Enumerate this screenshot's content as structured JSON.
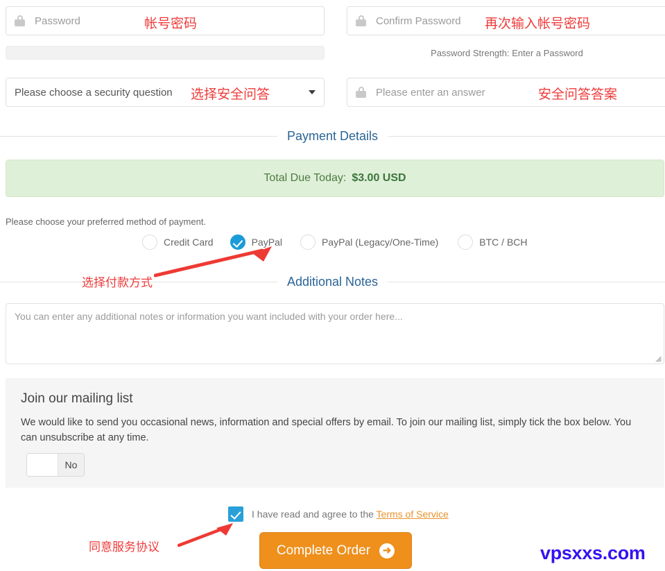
{
  "form": {
    "password_field": {
      "placeholder": "Password",
      "icon": "lock-icon"
    },
    "confirm_password_field": {
      "placeholder": "Confirm Password",
      "icon": "lock-icon"
    },
    "password_strength": "Password Strength: Enter a Password",
    "security_question_select": {
      "value": "Please choose a security question"
    },
    "security_answer_field": {
      "placeholder": "Please enter an answer",
      "icon": "lock-icon"
    }
  },
  "payment": {
    "section_title": "Payment Details",
    "total_label": "Total Due Today:",
    "total_amount": "$3.00 USD",
    "method_prompt": "Please choose your preferred method of payment.",
    "methods": [
      {
        "label": "Credit Card",
        "selected": false
      },
      {
        "label": "PayPal",
        "selected": true
      },
      {
        "label": "PayPal (Legacy/One-Time)",
        "selected": false
      },
      {
        "label": "BTC / BCH",
        "selected": false
      }
    ]
  },
  "notes": {
    "section_title": "Additional Notes",
    "placeholder": "You can enter any additional notes or information you want included with your order here..."
  },
  "mailing": {
    "heading": "Join our mailing list",
    "body": "We would like to send you occasional news, information and special offers by email. To join our mailing list, simply tick the box below. You can unsubscribe at any time.",
    "toggle_value": "No"
  },
  "terms": {
    "text": "I have read and agree to the ",
    "link": "Terms of Service",
    "checked": true
  },
  "cta": {
    "label": "Complete Order",
    "arrow": "➜"
  },
  "annotations": {
    "password": "帐号密码",
    "confirm_password": "再次输入帐号密码",
    "security_question": "选择安全问答",
    "security_answer": "安全问答答案",
    "payment_method": "选择付款方式",
    "agree_terms": "同意服务协议",
    "watermark": "vpsxxs.com"
  },
  "colors": {
    "accent_blue": "#2a6496",
    "radio_blue": "#1b9bd8",
    "cta_orange": "#ef8f1c",
    "total_green_bg": "#dff0d8",
    "annotation_red": "#ef3b3b",
    "watermark_blue": "#3412f0",
    "tos_orange": "#e8922b"
  }
}
